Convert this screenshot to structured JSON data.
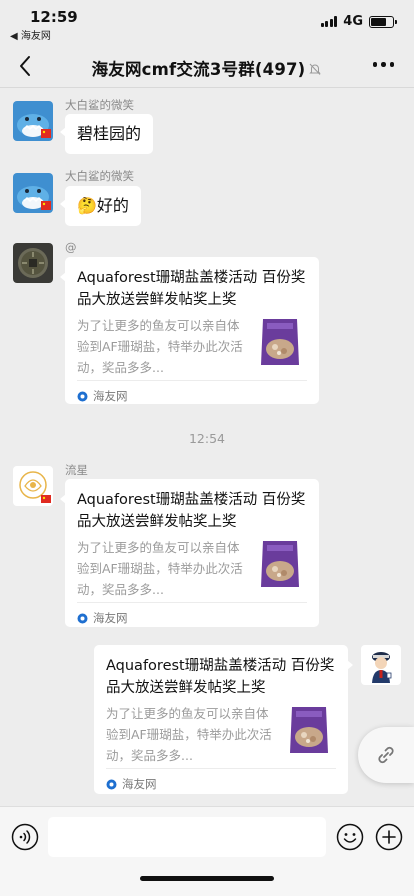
{
  "status_bar": {
    "time": "12:59",
    "back_app": "◀ 海友网",
    "network": "4G",
    "battery_level": 0.7
  },
  "nav": {
    "title": "海友网cmf交流3号群(497)",
    "back_icon": "chevron-left-icon",
    "mute_icon": "bell-off-icon",
    "more_icon": "ellipsis-icon"
  },
  "messages": [
    {
      "sender": "大白鲨的微笑",
      "text": "碧桂园的"
    },
    {
      "sender": "大白鲨的微笑",
      "emoji": "🤔",
      "text": "好的"
    },
    {
      "sender": "@",
      "card": {
        "title": "Aquaforest珊瑚盐盖楼活动 百份奖品大放送尝鲜发帖奖上奖",
        "desc": "为了让更多的鱼友可以亲自体验到AF珊瑚盐，特举办此次活动，奖品多多...",
        "source": "海友网"
      }
    },
    {
      "timestamp": "12:54"
    },
    {
      "sender": "流星",
      "card": {
        "title": "Aquaforest珊瑚盐盖楼活动 百份奖品大放送尝鲜发帖奖上奖",
        "desc": "为了让更多的鱼友可以亲自体验到AF珊瑚盐，特举办此次活动，奖品多多...",
        "source": "海友网"
      }
    },
    {
      "self": true,
      "card": {
        "title": "Aquaforest珊瑚盐盖楼活动 百份奖品大放送尝鲜发帖奖上奖",
        "desc": "为了让更多的鱼友可以亲自体验到AF珊瑚盐，特举办此次活动，奖品多多...",
        "source": "海友网"
      }
    }
  ],
  "input_bar": {
    "voice_icon": "voice-icon",
    "emoji_icon": "emoji-icon",
    "plus_icon": "plus-icon"
  },
  "colors": {
    "background": "#ededed",
    "bubble": "#ffffff",
    "meta_text": "#8a8a8a"
  }
}
